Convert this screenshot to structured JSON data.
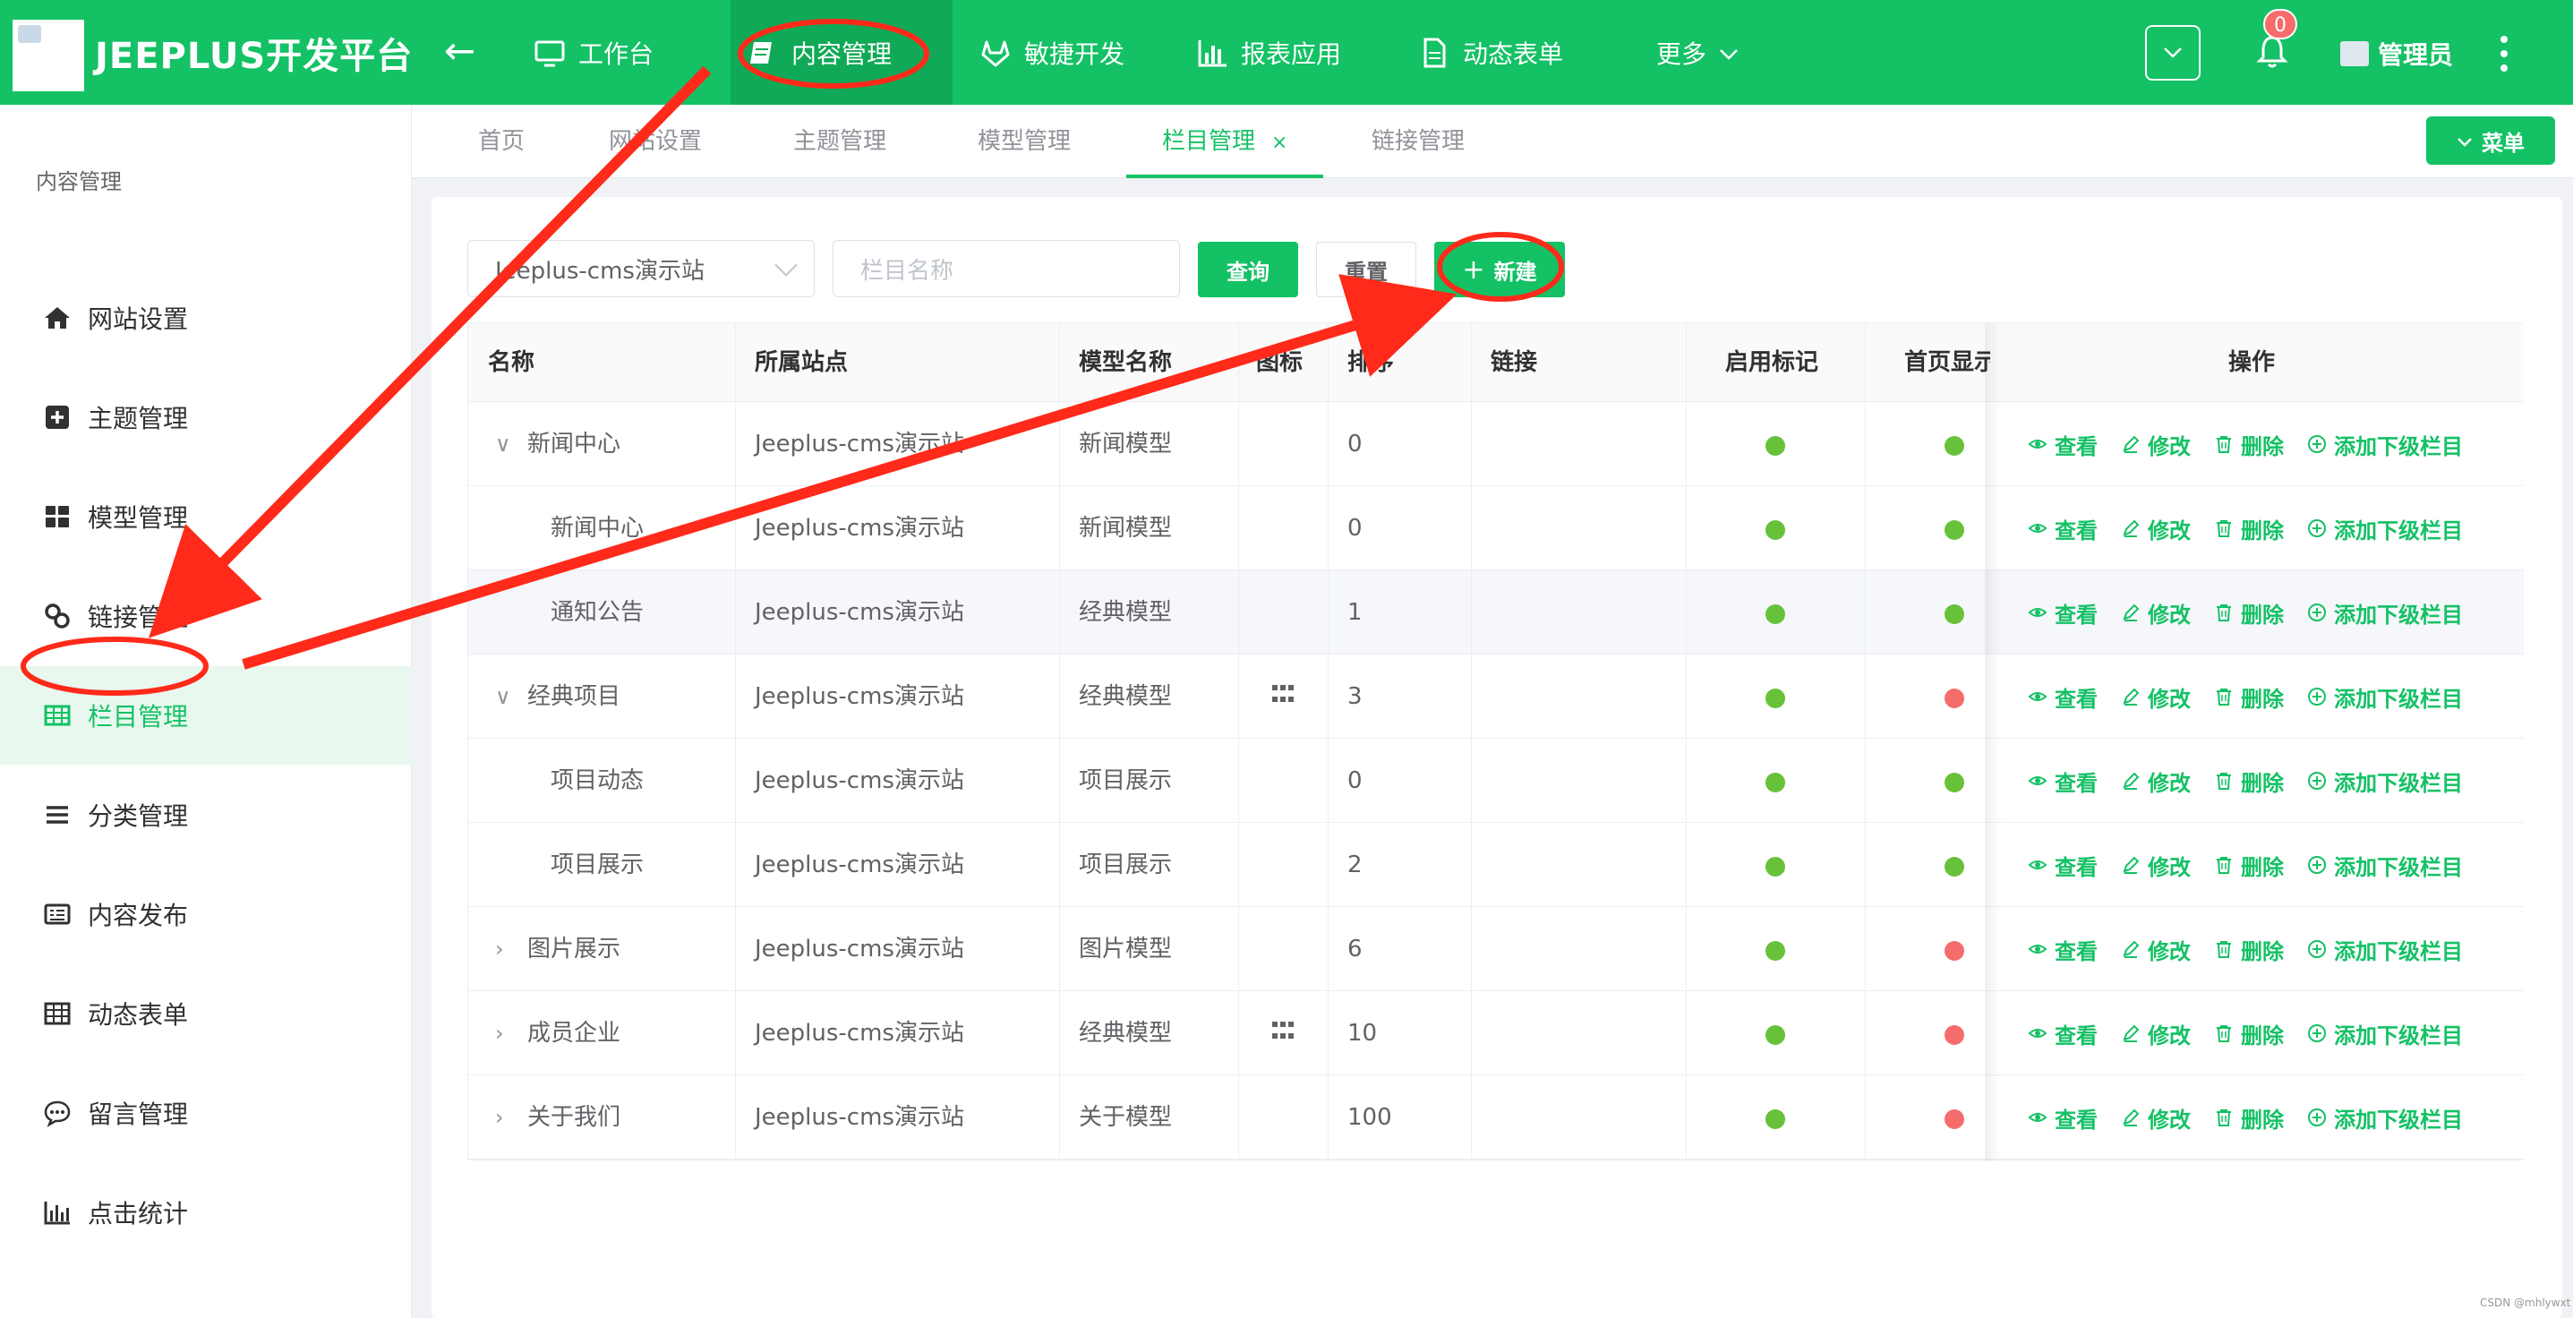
{
  "header": {
    "brand": "JEEPLUS开发平台",
    "nav": [
      {
        "label": "工作台",
        "icon": "monitor-icon"
      },
      {
        "label": "内容管理",
        "icon": "book-icon",
        "active": true
      },
      {
        "label": "敏捷开发",
        "icon": "gitlab-icon"
      },
      {
        "label": "报表应用",
        "icon": "bar-chart-icon"
      },
      {
        "label": "动态表单",
        "icon": "document-icon"
      },
      {
        "label": "更多",
        "icon": "chevron-down-icon"
      }
    ],
    "notifications": "0",
    "user": "管理员"
  },
  "sidebar": {
    "title": "内容管理",
    "items": [
      {
        "label": "网站设置",
        "icon": "home-icon"
      },
      {
        "label": "主题管理",
        "icon": "plus-square-icon"
      },
      {
        "label": "模型管理",
        "icon": "dashboard-icon"
      },
      {
        "label": "链接管理",
        "icon": "link-icon"
      },
      {
        "label": "栏目管理",
        "icon": "table-icon",
        "active": true
      },
      {
        "label": "分类管理",
        "icon": "list-icon"
      },
      {
        "label": "内容发布",
        "icon": "newspaper-icon"
      },
      {
        "label": "动态表单",
        "icon": "grid-icon"
      },
      {
        "label": "留言管理",
        "icon": "comment-icon"
      },
      {
        "label": "点击统计",
        "icon": "bar-chart-icon"
      }
    ]
  },
  "tabs": [
    "首页",
    "网站设置",
    "主题管理",
    "模型管理",
    "栏目管理",
    "链接管理"
  ],
  "active_tab": "栏目管理",
  "menu_button": "菜单",
  "filters": {
    "site_value": "Jeeplus-cms演示站",
    "name_placeholder": "栏目名称",
    "query": "查询",
    "reset": "重置",
    "new": "新建"
  },
  "table": {
    "columns": [
      "名称",
      "所属站点",
      "模型名称",
      "图标",
      "排序",
      "链接",
      "启用标记",
      "首页显示",
      "操作"
    ],
    "actions": [
      "查看",
      "修改",
      "删除",
      "添加下级栏目"
    ],
    "rows": [
      {
        "name": "新闻中心",
        "site": "Jeeplus-cms演示站",
        "model": "新闻模型",
        "icon": "",
        "sort": "0",
        "enabled": true,
        "home": true,
        "expand": "open",
        "level": 0
      },
      {
        "name": "新闻中心",
        "site": "Jeeplus-cms演示站",
        "model": "新闻模型",
        "icon": "",
        "sort": "0",
        "enabled": true,
        "home": true,
        "expand": "",
        "level": 1
      },
      {
        "name": "通知公告",
        "site": "Jeeplus-cms演示站",
        "model": "经典模型",
        "icon": "",
        "sort": "1",
        "enabled": true,
        "home": true,
        "expand": "",
        "level": 1
      },
      {
        "name": "经典项目",
        "site": "Jeeplus-cms演示站",
        "model": "经典模型",
        "icon": "grid",
        "sort": "3",
        "enabled": true,
        "home": false,
        "expand": "open",
        "level": 0
      },
      {
        "name": "项目动态",
        "site": "Jeeplus-cms演示站",
        "model": "项目展示",
        "icon": "",
        "sort": "0",
        "enabled": true,
        "home": true,
        "expand": "",
        "level": 1
      },
      {
        "name": "项目展示",
        "site": "Jeeplus-cms演示站",
        "model": "项目展示",
        "icon": "",
        "sort": "2",
        "enabled": true,
        "home": true,
        "expand": "",
        "level": 1
      },
      {
        "name": "图片展示",
        "site": "Jeeplus-cms演示站",
        "model": "图片模型",
        "icon": "",
        "sort": "6",
        "enabled": true,
        "home": false,
        "expand": "closed",
        "level": 0
      },
      {
        "name": "成员企业",
        "site": "Jeeplus-cms演示站",
        "model": "经典模型",
        "icon": "grid",
        "sort": "10",
        "enabled": true,
        "home": false,
        "expand": "closed",
        "level": 0
      },
      {
        "name": "关于我们",
        "site": "Jeeplus-cms演示站",
        "model": "关于模型",
        "icon": "",
        "sort": "100",
        "enabled": true,
        "home": false,
        "expand": "closed",
        "level": 0
      }
    ]
  },
  "colors": {
    "brand": "#14c165",
    "dot_on": "#67c23a",
    "dot_off": "#f56c6c",
    "annotation": "#ff2a1a"
  },
  "watermark": "CSDN @mhlywxt"
}
